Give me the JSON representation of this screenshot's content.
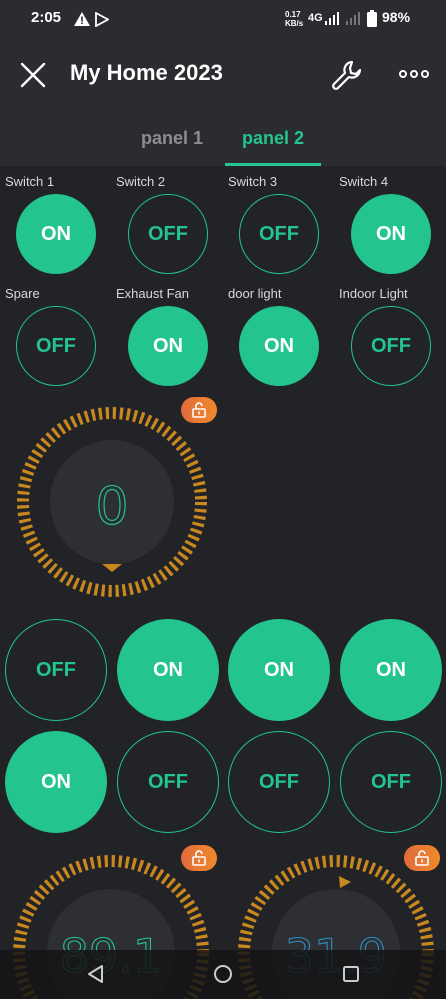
{
  "status_bar": {
    "time": "2:05",
    "net_speed_top": "0.17",
    "net_speed_bottom": "KB/s",
    "network": "4G",
    "battery": "98%"
  },
  "app_bar": {
    "title": "My Home 2023"
  },
  "tabs": [
    {
      "label": "panel 1",
      "active": false
    },
    {
      "label": "panel 2",
      "active": true
    }
  ],
  "switch_row_1": [
    {
      "label": "Switch 1",
      "state": "ON"
    },
    {
      "label": "Switch 2",
      "state": "OFF"
    },
    {
      "label": "Switch 3",
      "state": "OFF"
    },
    {
      "label": "Switch 4",
      "state": "ON"
    }
  ],
  "switch_row_2": [
    {
      "label": "Spare",
      "state": "OFF"
    },
    {
      "label": "Exhaust Fan",
      "state": "ON"
    },
    {
      "label": "door light",
      "state": "ON"
    },
    {
      "label": "Indoor Light",
      "state": "OFF"
    }
  ],
  "gauge_main": {
    "value": "0"
  },
  "button_row_3": [
    "OFF",
    "ON",
    "ON",
    "ON"
  ],
  "button_row_4": [
    "ON",
    "OFF",
    "OFF",
    "OFF"
  ],
  "gauge_left": {
    "value": "89.1"
  },
  "gauge_right": {
    "value": "31.9"
  },
  "colors": {
    "accent": "#23c48e",
    "background": "#222326",
    "bar": "#2b2c30",
    "dial": "#c8871f",
    "lock": "#e9762f",
    "gauge_right_text": "#2d8fc4"
  }
}
